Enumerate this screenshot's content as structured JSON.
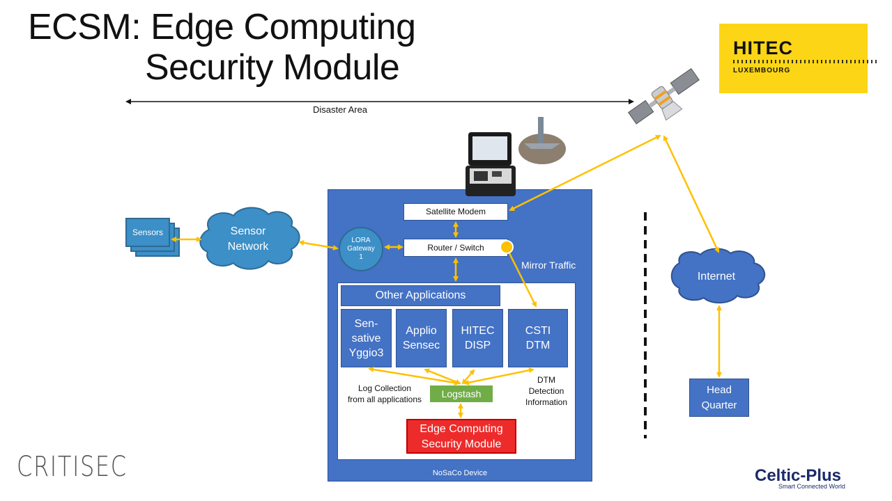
{
  "slide": {
    "title_line1": "ECSM: Edge Computing",
    "title_line2": "Security Module",
    "disaster_area_label": "Disaster Area"
  },
  "logos": {
    "hitec": {
      "name": "HITEC",
      "sub": "LUXEMBOURG",
      "color": "#fcd616"
    },
    "critisec": {
      "name": "CRITISEC"
    },
    "celtic_plus": {
      "name": "Celtic-Plus",
      "tagline": "Smart Connected World"
    }
  },
  "left_side": {
    "sensors_label": "Sensors",
    "sensor_network_label": "Sensor\nNetwork"
  },
  "device": {
    "label": "NoSaCo Device",
    "satellite_modem": "Satellite Modem",
    "router_switch": "Router / Switch",
    "lora_gateway": "LORA Gateway 1",
    "mirror_traffic": "Mirror Traffic",
    "other_applications": "Other Applications",
    "apps": [
      {
        "label": "Sen-\nsative\nYggio3"
      },
      {
        "label": "Applio\nSensec"
      },
      {
        "label": "HITEC\nDISP"
      },
      {
        "label": "CSTI\nDTM"
      }
    ],
    "log_collection_note": "Log Collection\nfrom all applications",
    "dtm_note": "DTM\nDetection\nInformation",
    "logstash": "Logstash",
    "ecsm": "Edge Computing\nSecurity Module"
  },
  "right_side": {
    "internet_label": "Internet",
    "head_quarter_label": "Head\nQuarter"
  },
  "colors": {
    "device_blue": "#4472c4",
    "arrow_yellow": "#ffc000",
    "cloud_blue_sensor": "#3c8fc7",
    "logstash_green": "#70ad47",
    "ecsm_red": "#ee2b2b"
  }
}
